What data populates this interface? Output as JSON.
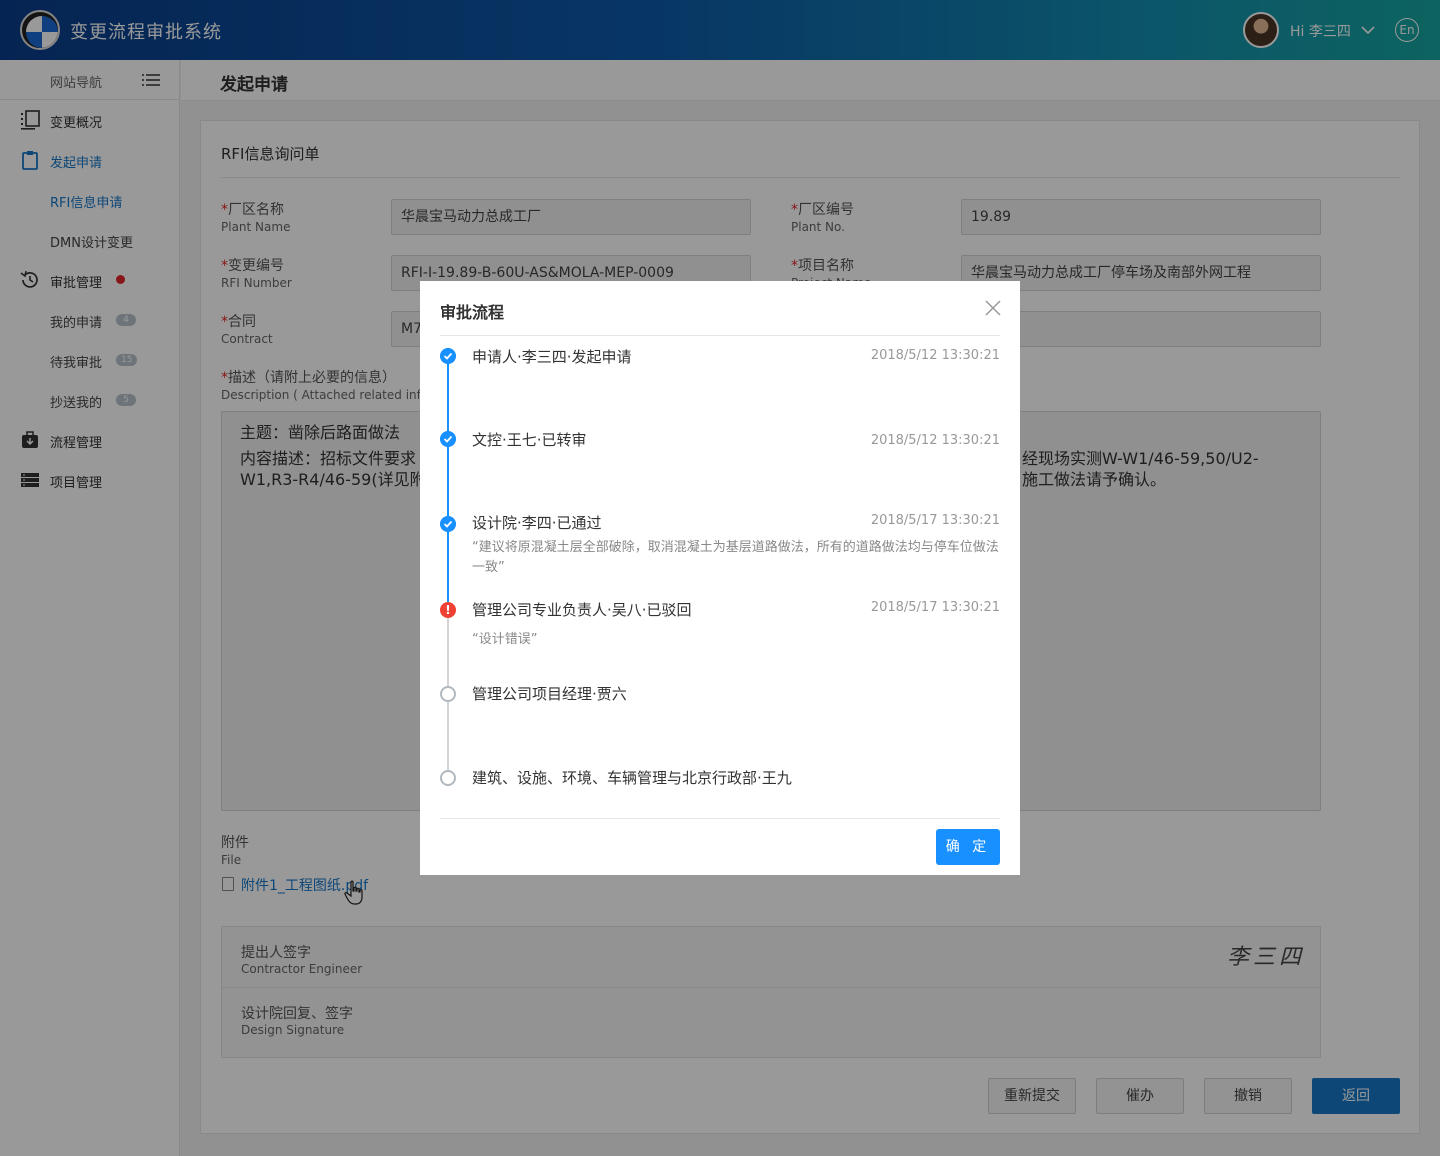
{
  "header": {
    "app_title": "变更流程审批系统",
    "greeting": "Hi 李三四",
    "lang": "En"
  },
  "sidebar": {
    "nav_title": "网站导航",
    "items": [
      {
        "label": "变更概况",
        "icon": "list-icon"
      },
      {
        "label": "发起申请",
        "icon": "clipboard-icon",
        "active": true
      },
      {
        "label": "RFI信息申请",
        "sub": true,
        "active": true
      },
      {
        "label": "DMN设计变更",
        "sub": true
      },
      {
        "label": "审批管理",
        "icon": "history-icon"
      },
      {
        "label": "我的申请",
        "sub": true,
        "badge": "4"
      },
      {
        "label": "待我审批",
        "sub": true,
        "badge": "15"
      },
      {
        "label": "抄送我的",
        "sub": true,
        "badge": "5"
      },
      {
        "label": "流程管理",
        "icon": "toolbox-icon"
      },
      {
        "label": "项目管理",
        "icon": "stack-icon"
      }
    ]
  },
  "page": {
    "title": "发起申请",
    "form_title": "RFI信息询问单",
    "fields": {
      "plant_name": {
        "label": "厂区名称",
        "en": "Plant Name",
        "value": "华晨宝马动力总成工厂"
      },
      "plant_no": {
        "label": "厂区编号",
        "en": "Plant No.",
        "value": "19.89"
      },
      "rfi_number": {
        "label": "变更编号",
        "en": "RFI Number",
        "value": "RFI-I-19.89-B-60U-AS&MOLA-MEP-0009"
      },
      "project_name": {
        "label": "项目名称",
        "en": "Project Name",
        "value": "华晨宝马动力总成工厂停车场及南部外网工程"
      },
      "contract": {
        "label": "合同",
        "en": "Contract",
        "value": "M7"
      },
      "description": {
        "label": "描述（请附上必要的信息）",
        "en": "Description ( Attached related info"
      }
    },
    "req_mark": "*",
    "desc_text": {
      "subject": "主题：凿除后路面做法",
      "left_line1": "内容描述：招标文件要求",
      "left_line2": "W1,R3-R4/46-59(详见附",
      "right_line1": "经现场实测W-W1/46-59,50/U2-",
      "right_line2": "施工做法请予确认。"
    },
    "attachment": {
      "label": "附件",
      "en": "File",
      "file": "附件1_工程图纸.pdf"
    },
    "signature_rows": [
      {
        "label": "提出人签字",
        "en": "Contractor Engineer",
        "signature": "李三四"
      },
      {
        "label": "设计院回复、签字",
        "en": "Design  Signature"
      }
    ],
    "buttons": {
      "resubmit": "重新提交",
      "urge": "催办",
      "revoke": "撤销",
      "back": "返回"
    }
  },
  "modal": {
    "title": "审批流程",
    "ok": "确 定",
    "steps": [
      {
        "title": "申请人·李三四·发起申请",
        "time": "2018/5/12 13:30:21",
        "status": "done"
      },
      {
        "title": "文控·王七·已转审",
        "time": "2018/5/12 13:30:21",
        "status": "done"
      },
      {
        "title": "设计院·李四·已通过",
        "time": "2018/5/17 13:30:21",
        "status": "done",
        "comment": "“建议将原混凝土层全部破除，取消混凝土为基层道路做法，所有的道路做法均与停车位做法一致”"
      },
      {
        "title": "管理公司专业负责人·吴八·已驳回",
        "time": "2018/5/17 13:30:21",
        "status": "error",
        "comment": "“设计错误”"
      },
      {
        "title": "管理公司项目经理·贾六",
        "status": "pending"
      },
      {
        "title": "建筑、设施、环境、车辆管理与北京行政部·王九",
        "status": "pending"
      }
    ]
  },
  "colors": {
    "accent": "#1677c8",
    "timeline_blue": "#1890ff",
    "error": "#f04134",
    "header_start": "#0a3d8a",
    "header_end": "#16a6a0"
  }
}
